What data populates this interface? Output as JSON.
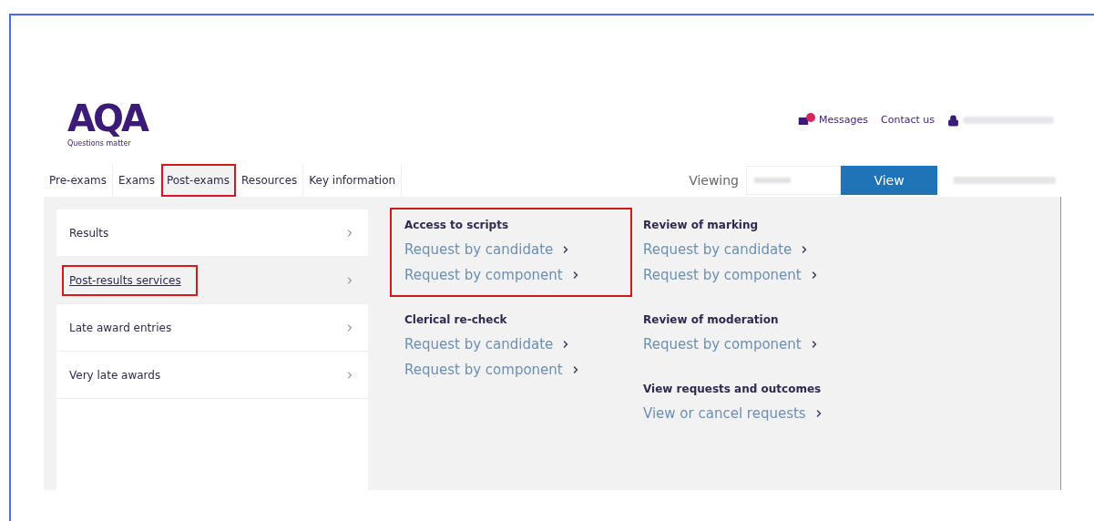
{
  "logo": {
    "name": "AQA",
    "tagline": "Questions matter"
  },
  "utility_links": [
    {
      "kind": "messages",
      "label": "Messages"
    },
    {
      "kind": "link",
      "label": "Contact us"
    },
    {
      "kind": "account"
    }
  ],
  "nav": [
    {
      "label": "Pre-exams",
      "selected": false,
      "highlighted": false
    },
    {
      "label": "Exams",
      "selected": false,
      "highlighted": false
    },
    {
      "label": "Post-exams",
      "selected": true,
      "highlighted": true
    },
    {
      "label": "Resources",
      "selected": false,
      "highlighted": false
    },
    {
      "label": "Key information",
      "selected": false,
      "highlighted": false
    }
  ],
  "viewing": {
    "label": "Viewing",
    "button": "View"
  },
  "menu": [
    {
      "label": "Results",
      "selected": false,
      "highlighted": false
    },
    {
      "label": "Post-results services",
      "selected": true,
      "highlighted": true
    },
    {
      "label": "Late award entries",
      "selected": false,
      "highlighted": false
    },
    {
      "label": "Very late awards",
      "selected": false,
      "highlighted": false
    }
  ],
  "columns": [
    [
      {
        "title": "Access to scripts",
        "highlighted": true,
        "links": [
          "Request by candidate",
          "Request by component"
        ]
      },
      {
        "title": "Clerical re-check",
        "highlighted": false,
        "links": [
          "Request by candidate",
          "Request by component"
        ]
      }
    ],
    [
      {
        "title": "Review of marking",
        "highlighted": false,
        "links": [
          "Request by candidate",
          "Request by component"
        ]
      },
      {
        "title": "Review of moderation",
        "highlighted": false,
        "links": [
          "Request by component"
        ]
      },
      {
        "title": "View requests and outcomes",
        "highlighted": false,
        "links": [
          "View or cancel requests"
        ]
      }
    ]
  ]
}
